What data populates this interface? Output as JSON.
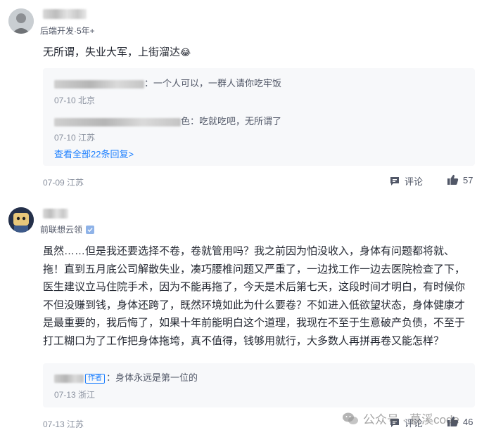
{
  "comments": [
    {
      "author_title": "后端开发·5年+",
      "content": "无所谓，失业大军，上街溜达",
      "emoji": "😂",
      "replies": [
        {
          "text": "：一个人可以，一群人请你吃牢饭",
          "date": "07-10",
          "location": "北京"
        },
        {
          "text": "色：吃就吃吧，无所谓了",
          "date": "07-10",
          "location": "江苏"
        }
      ],
      "view_all": "查看全部22条回复>",
      "date": "07-09",
      "location": "江苏",
      "comment_label": "评论",
      "likes": "57"
    },
    {
      "author_title": "前联想云领",
      "content": "虽然……但是我还要选择不卷，卷就管用吗？我之前因为怕没收入，身体有问题都将就、拖！直到五月底公司解散失业，凑巧腰椎问题又严重了，一边找工作一边去医院检查了下，医生建议立马住院手术，因为不能再拖了，今天是术后第七天，这段时间才明白，有时候你不但没赚到钱，身体还跨了，既然环境如此为什么要卷？不如进入低欲望状态，身体健康才是最重要的，我后悔了，如果十年前能明白这个道理，我现在不至于生意破产负债，不至于打工糊口为了工作把身体拖垮，真不值得，钱够用就行，大多数人再拼再卷又能怎样？",
      "replies": [
        {
          "author_tag": "作者",
          "text": "：身体永远是第一位的",
          "date": "07-13",
          "location": "浙江"
        }
      ],
      "date": "07-13",
      "location": "江苏",
      "comment_label": "评论",
      "likes": "46"
    }
  ],
  "watermark": "公众号 · 慕溪code"
}
